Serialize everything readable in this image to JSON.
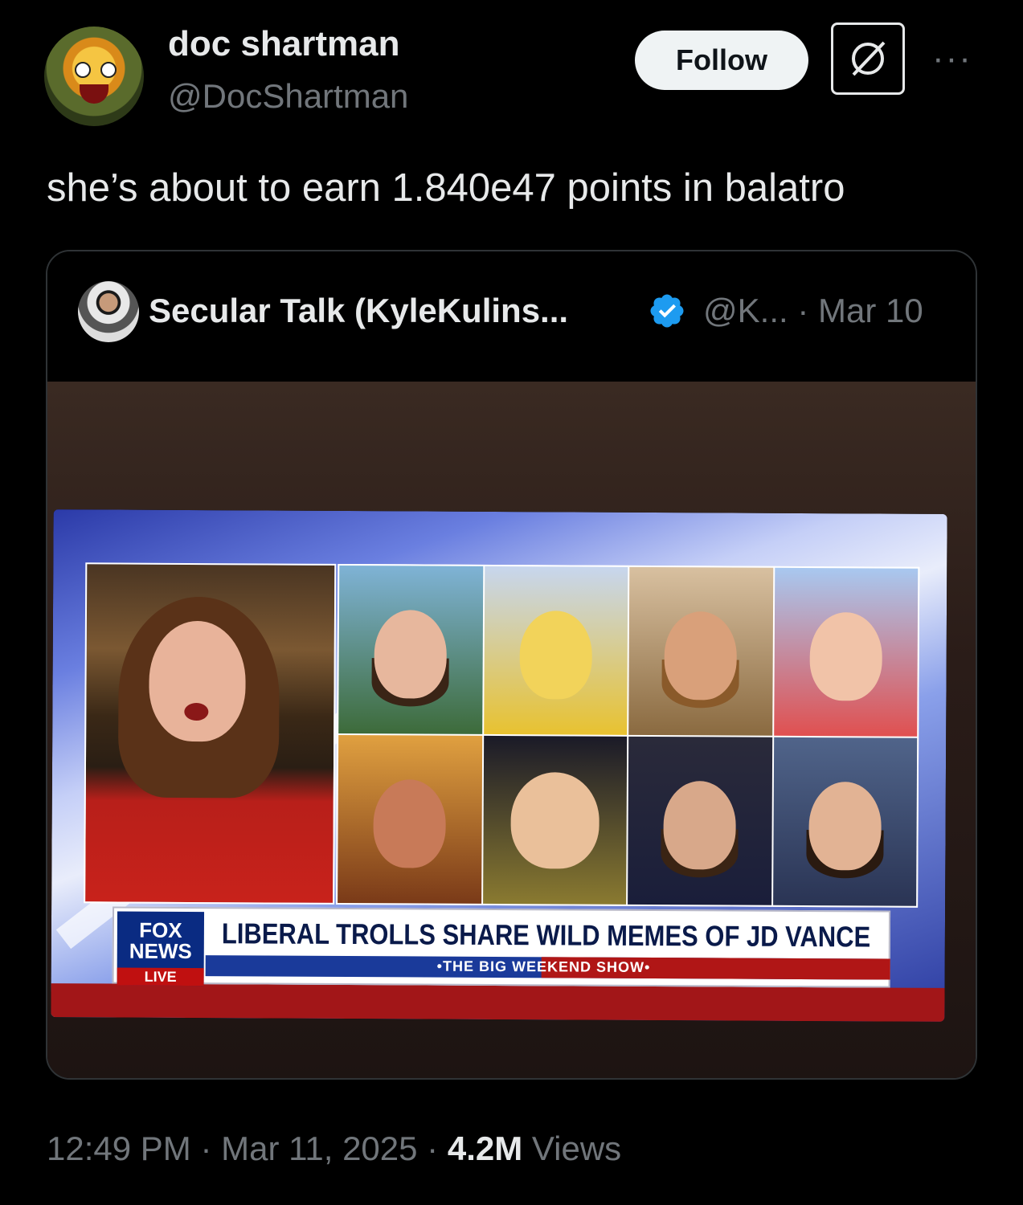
{
  "author": {
    "display_name": "doc shartman",
    "handle": "@DocShartman"
  },
  "actions": {
    "follow_label": "Follow",
    "more_label": "···"
  },
  "tweet": {
    "text": "she’s about to earn 1.840e47 points in balatro"
  },
  "quoted": {
    "display_name": "Secular Talk (KyleKulins...",
    "handle": "@K...",
    "separator": "·",
    "date": "Mar 10",
    "verified": true,
    "tv": {
      "network_line1": "FOX",
      "network_line2": "NEWS",
      "network_live": "LIVE",
      "headline": "LIBERAL TROLLS SHARE WILD MEMES OF JD VANCE",
      "show_name": "•THE BIG WEEKEND SHOW•"
    }
  },
  "footer": {
    "time": "12:49 PM",
    "date": "Mar 11, 2025",
    "views_count": "4.2M",
    "views_label": "Views",
    "sep": "·"
  },
  "colors": {
    "background": "#000000",
    "text_primary": "#e7e9ea",
    "text_secondary": "#71767b",
    "verified_blue": "#1d9bf0"
  }
}
